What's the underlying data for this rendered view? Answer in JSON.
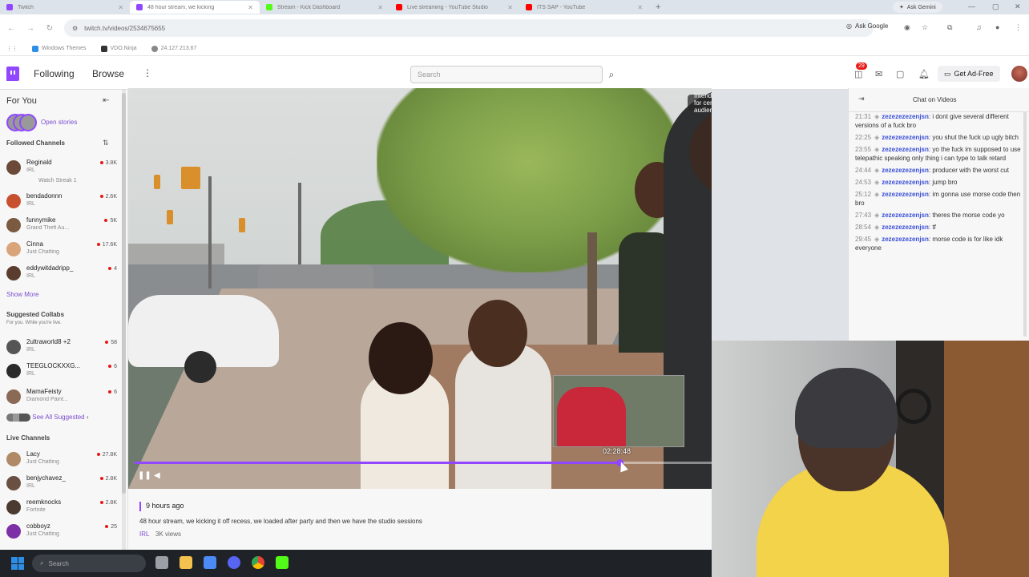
{
  "browser": {
    "tabs": [
      {
        "title": "Twitch",
        "fav": "#9147ff",
        "active": false
      },
      {
        "title": "48 hour stream, we kicking",
        "fav": "#9147ff",
        "active": true
      },
      {
        "title": "Stream - Kick Dashboard",
        "fav": "#53fc18",
        "active": false
      },
      {
        "title": "Live streaming - YouTube Studio",
        "fav": "#ff0000",
        "active": false
      },
      {
        "title": "ITS SAP - YouTube",
        "fav": "#ff0000",
        "active": false
      }
    ],
    "new_tab": "+",
    "ask_gemini": "Ask Gemini",
    "url": "twitch.tv/videos/2534675655",
    "ask_google": "Ask Google",
    "bookmarks": [
      {
        "label": "Windows Themes",
        "color": "#2e8ee6"
      },
      {
        "label": "VDO.Ninja",
        "color": "#333333"
      },
      {
        "label": "24.127.213.67",
        "color": "#888888"
      }
    ]
  },
  "twitch_nav": {
    "following": "Following",
    "browse": "Browse",
    "more": "⋮",
    "search_placeholder": "Search",
    "notifications_count": "29",
    "get_ad_free": "Get Ad-Free"
  },
  "sidebar": {
    "for_you": "For You",
    "open_stories": "Open stories",
    "followed_channels": "Followed Channels",
    "followed": [
      {
        "name": "Reginald",
        "game": "IRL",
        "extra": "Watch Streak 1",
        "viewers": "3.8K",
        "color": "#6b4a3a"
      },
      {
        "name": "bendadonnn",
        "game": "IRL",
        "viewers": "2.6K",
        "color": "#c8502f"
      },
      {
        "name": "funnymike",
        "game": "Grand Theft Au...",
        "viewers": "5K",
        "color": "#7a5a40"
      },
      {
        "name": "Cinna",
        "game": "Just Chatting",
        "viewers": "17.6K",
        "color": "#d9a47a"
      },
      {
        "name": "eddywitdadripp_",
        "game": "IRL",
        "viewers": "4",
        "color": "#5a3d2e"
      }
    ],
    "show_more": "Show More",
    "suggested_collabs": "Suggested Collabs",
    "suggested_sub": "For you. While you're live.",
    "suggested": [
      {
        "name": "2ultraworld8 +2",
        "game": "IRL",
        "viewers": "58",
        "color": "#555555"
      },
      {
        "name": "TEEGLOCKXXG...",
        "game": "IRL",
        "viewers": "6",
        "color": "#2a2a2a"
      },
      {
        "name": "MamaFeisty",
        "game": "Diamond Paint...",
        "viewers": "6",
        "color": "#8a6a55"
      }
    ],
    "see_all_suggested": "See All Suggested",
    "live_channels": "Live Channels",
    "live": [
      {
        "name": "Lacy",
        "game": "Just Chatting",
        "viewers": "27.8K",
        "color": "#b08a66"
      },
      {
        "name": "benjychavez_",
        "game": "IRL",
        "viewers": "2.8K",
        "color": "#6a5040"
      },
      {
        "name": "reemknocks",
        "game": "Fortnite",
        "viewers": "2.8K",
        "color": "#4a3a30"
      },
      {
        "name": "cobboyz",
        "game": "Just Chatting",
        "viewers": "25",
        "color": "#7d2fa5"
      }
    ]
  },
  "video": {
    "audience_label": "Intended for certain audiences",
    "preview_time": "02:28:48",
    "progress_fraction": 0.84,
    "posted_ago": "9 hours ago",
    "description": "48 hour stream, we kicking it off recess, we loaded after party and then we have the studio sessions",
    "category": "IRL",
    "views": "3K views"
  },
  "chat": {
    "title": "Chat on Videos",
    "messages": [
      {
        "ts": "21:31",
        "user": "zezezezezenjsn",
        "text": "i dont give several different versions of a fuck bro"
      },
      {
        "ts": "22:25",
        "user": "zezezezezenjsn",
        "text": "you shut the fuck up ugly bitch"
      },
      {
        "ts": "23:55",
        "user": "zezezezezenjsn",
        "text": "yo the fuck im supposed to use telepathic speaking only thing i can type to talk retard"
      },
      {
        "ts": "24:44",
        "user": "zezezezezenjsn",
        "text": "producer with the worst cut"
      },
      {
        "ts": "24:53",
        "user": "zezezezezenjsn",
        "text": "jump bro"
      },
      {
        "ts": "25:12",
        "user": "zezezezezenjsn",
        "text": "im gonna use morse code then bro"
      },
      {
        "ts": "27:43",
        "user": "zezezezezenjsn",
        "text": "theres the morse code yo"
      },
      {
        "ts": "28:54",
        "user": "zezezezezenjsn",
        "text": "tf"
      },
      {
        "ts": "29:45",
        "user": "zezezezezenjsn",
        "text": "morse code is for like idk everyone"
      }
    ]
  },
  "taskbar": {
    "search_placeholder": "Search",
    "apps": [
      {
        "name": "task-view",
        "color": "#9aa0a6"
      },
      {
        "name": "file-explorer",
        "color": "#f2c14e"
      },
      {
        "name": "store",
        "color": "#4c8bf5"
      },
      {
        "name": "discord",
        "color": "#5865f2"
      },
      {
        "name": "chrome",
        "color": "#34a853"
      },
      {
        "name": "kick",
        "color": "#53fc18"
      }
    ]
  }
}
